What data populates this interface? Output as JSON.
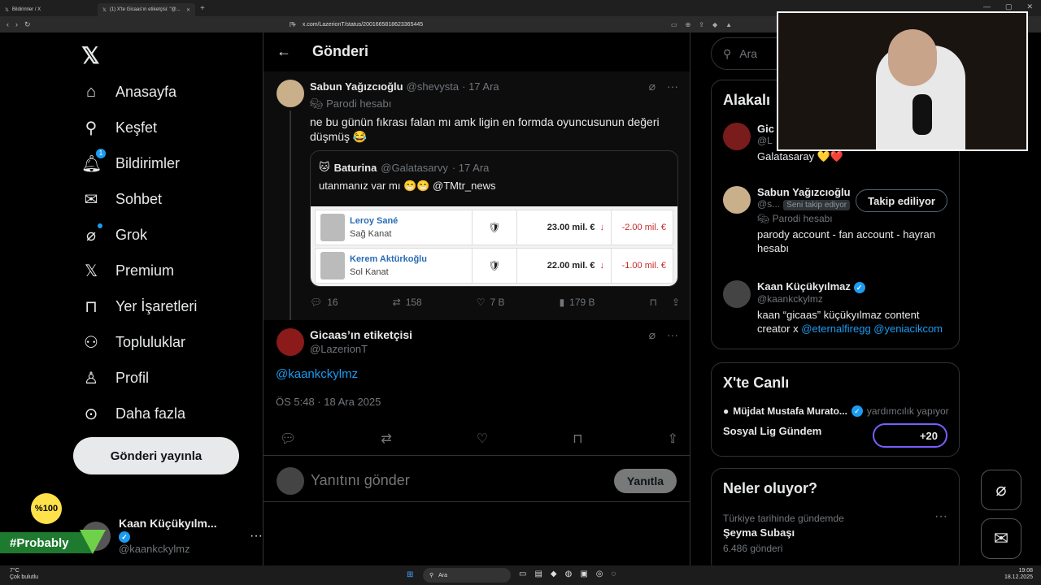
{
  "browser": {
    "tabs": [
      {
        "label": "Bildirimler / X"
      },
      {
        "label": "(1) X'te Gicaas'ın etiketçisi: \"@..."
      }
    ],
    "url": "x.com/LazerionT/status/2001665818623365445"
  },
  "nav": {
    "items": [
      {
        "label": "Anasayfa"
      },
      {
        "label": "Keşfet"
      },
      {
        "label": "Bildirimler",
        "badge": "1"
      },
      {
        "label": "Sohbet"
      },
      {
        "label": "Grok"
      },
      {
        "label": "Premium"
      },
      {
        "label": "Yer İşaretleri"
      },
      {
        "label": "Topluluklar"
      },
      {
        "label": "Profil"
      },
      {
        "label": "Daha fazla"
      }
    ],
    "post_button": "Gönderi yayınla",
    "account": {
      "name": "Kaan Küçükyılm...",
      "handle": "@kaankckylmz"
    }
  },
  "overlay": {
    "logo": "%100",
    "tag": "#Probably"
  },
  "main": {
    "title": "Gönderi",
    "parent_tweet": {
      "name": "Sabun Yağızcıoğlu",
      "handle": "@shevysta",
      "date": "· 17 Ara",
      "label": "Parodi hesabı",
      "text": "ne bu günün fıkrası falan mı amk ligin en formda oyuncusunun değeri düşmüş 😂",
      "quote": {
        "name": "Baturina",
        "handle": "@Galatasarvy",
        "date": "· 17 Ara",
        "text": "utanmanız var mı 😁😁 @TMtr_news",
        "rows": [
          {
            "player": "Leroy Sané",
            "position": "Sağ Kanat",
            "value": "23.00 mil. €",
            "change": "-2.00 mil. €"
          },
          {
            "player": "Kerem Aktürkoğlu",
            "position": "Sol Kanat",
            "value": "22.00 mil. €",
            "change": "-1.00 mil. €"
          }
        ]
      },
      "stats": {
        "replies": "16",
        "reposts": "158",
        "likes": "7 B",
        "views": "179 B"
      }
    },
    "tweet": {
      "name": "Gicaas’ın etiketçisi",
      "handle": "@LazerionT",
      "text": "@kaankckylmz",
      "time": "ÖS 5:48 · 18 Ara 2025"
    },
    "reply": {
      "placeholder": "Yanıtını gönder",
      "button": "Yanıtla"
    }
  },
  "sidebar": {
    "search_placeholder": "Ara",
    "related_title": "Alakalı",
    "related": [
      {
        "name": "Gic",
        "handle": "@L",
        "bio": "Galatasaray 💛❤️"
      },
      {
        "name": "Sabun Yağızcıoğlu",
        "handle": "@s...",
        "follows_you": "Seni takip ediyor",
        "label": "Parodi hesabı",
        "bio": "parody account - fan account - hayran hesabı",
        "button": "Takip ediliyor"
      },
      {
        "name": "Kaan Küçükyılmaz",
        "handle": "@kaankckylmz",
        "bio": "kaan “gicaas” küçükyılmaz content creator x",
        "links": "@eternalfiregg @yeniacikcom"
      }
    ],
    "live": {
      "title": "X'te Canlı",
      "host": "Müjdat Mustafa Murato...",
      "host_status": "yardımcılık yapıyor",
      "space": "Sosyal Lig Gündem",
      "count": "+20"
    },
    "trends": {
      "title": "Neler oluyor?",
      "context": "Türkiye tarihinde gündemde",
      "topic": "Şeyma Subaşı",
      "posts": "6.486 gönderi"
    }
  },
  "taskbar": {
    "weather_temp": "7°C",
    "weather_desc": "Çok bulutlu",
    "search": "Ara",
    "time": "19:08",
    "date": "18.12.2025"
  }
}
